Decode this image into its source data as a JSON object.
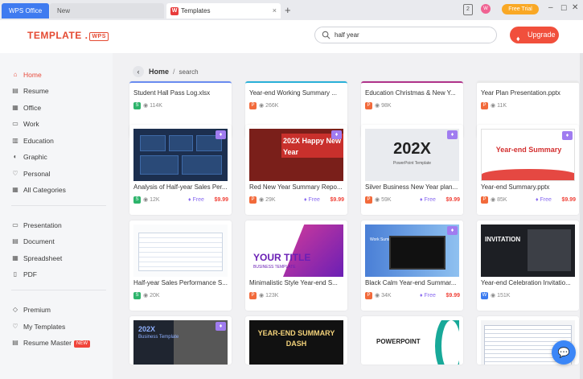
{
  "tabs": {
    "wps_office": "WPS Office",
    "new_tab": "New",
    "templates_tab": "Templates",
    "templates_icon_glyph": "W",
    "close_glyph": "×",
    "add_glyph": "+"
  },
  "titlebar": {
    "badge": "2",
    "avatar_initial": "W",
    "free_trial": "Free Trial",
    "min_glyph": "–",
    "max_glyph": "☐",
    "close_glyph": "✕"
  },
  "header": {
    "logo_text": "TEMPLATE .",
    "logo_badge": "WPS",
    "search": {
      "value": "half year"
    },
    "upgrade": "Upgrade",
    "upgrade_icon_glyph": "♦"
  },
  "sidebar": {
    "items": [
      {
        "label": "Home",
        "icon": "home-icon",
        "glyph": "⌂"
      },
      {
        "label": "Resume",
        "icon": "resume-icon",
        "glyph": "▤"
      },
      {
        "label": "Office",
        "icon": "office-icon",
        "glyph": "▦"
      },
      {
        "label": "Work",
        "icon": "briefcase-icon",
        "glyph": "▭"
      },
      {
        "label": "Education",
        "icon": "education-icon",
        "glyph": "▥"
      },
      {
        "label": "Graphic",
        "icon": "graphic-icon",
        "glyph": "◐"
      },
      {
        "label": "Personal",
        "icon": "personal-icon",
        "glyph": "♡"
      },
      {
        "label": "All Categories",
        "icon": "grid-icon",
        "glyph": "▦"
      }
    ],
    "types": [
      {
        "label": "Presentation",
        "icon": "presentation-icon",
        "glyph": "▭"
      },
      {
        "label": "Document",
        "icon": "document-icon",
        "glyph": "▤"
      },
      {
        "label": "Spreadsheet",
        "icon": "spreadsheet-icon",
        "glyph": "▦"
      },
      {
        "label": "PDF",
        "icon": "pdf-icon",
        "glyph": "▯"
      }
    ],
    "extras": [
      {
        "label": "Premium",
        "icon": "premium-icon",
        "glyph": "◇"
      },
      {
        "label": "My Templates",
        "icon": "heart-icon",
        "glyph": "♡"
      },
      {
        "label": "Resume Master",
        "icon": "resume-master-icon",
        "glyph": "▤",
        "badge": "NEW"
      }
    ]
  },
  "breadcrumb": {
    "back_glyph": "‹",
    "home": "Home",
    "sep": "/",
    "current": "search"
  },
  "cards_row0": [
    {
      "title": "Student Hall Pass Log.xlsx",
      "type": "S",
      "views": "114K"
    },
    {
      "title": "Year-end Working Summary ...",
      "type": "P",
      "views": "266K"
    },
    {
      "title": "Education Christmas & New Y...",
      "type": "P",
      "views": "98K"
    },
    {
      "title": "Year Plan Presentation.pptx",
      "type": "P",
      "views": "11K"
    }
  ],
  "cards_row1": [
    {
      "title": "Analysis of Half-year Sales Per...",
      "type": "S",
      "views": "12K",
      "free": "Free",
      "price": "$9.99",
      "thumb_text": "",
      "thumb_sub": ""
    },
    {
      "title": "Red New Year Summary Repo...",
      "type": "P",
      "views": "29K",
      "free": "Free",
      "price": "$9.99",
      "thumb_text": "202X Happy New Year",
      "thumb_sub": ""
    },
    {
      "title": "Silver Business New Year plan...",
      "type": "P",
      "views": "59K",
      "free": "Free",
      "price": "$9.99",
      "thumb_text": "202X",
      "thumb_sub": "PowerPoint Template"
    },
    {
      "title": "Year-end Summary.pptx",
      "type": "P",
      "views": "85K",
      "free": "Free",
      "price": "$9.99",
      "thumb_text": "Year-end Summary",
      "thumb_sub": ""
    }
  ],
  "cards_row2": [
    {
      "title": "Half-year Sales Performance S...",
      "type": "S",
      "views": "20K",
      "thumb_text": "",
      "thumb_sub": ""
    },
    {
      "title": "Minimalistic Style Year-end S...",
      "type": "P",
      "views": "123K",
      "thumb_text": "YOUR TITLE",
      "thumb_sub": "BUSINESS TEMPLATE"
    },
    {
      "title": "Black Calm Year-end Summar...",
      "type": "P",
      "views": "34K",
      "free": "Free",
      "price": "$9.99",
      "thumb_text": "Work Summary",
      "thumb_sub": ""
    },
    {
      "title": "Year-end Celebration Invitatio...",
      "type": "W",
      "views": "151K",
      "thumb_text": "INVITATION",
      "thumb_sub": ""
    }
  ],
  "cards_row3": [
    {
      "thumb_text": "202X",
      "thumb_sub": "Business Template"
    },
    {
      "thumb_text": "YEAR-END SUMMARY DASH",
      "thumb_sub": ""
    },
    {
      "thumb_text": "POWERPOINT",
      "thumb_sub": ""
    },
    {
      "thumb_text": "",
      "thumb_sub": ""
    }
  ],
  "vip_glyph": "♦",
  "eye_glyph": "◉",
  "free_glyph": "♦",
  "chat_glyph": "💬",
  "colors": {
    "accent": "#e84b3b",
    "tab_active": "#3f7bf0",
    "upgrade": "#f14f3c",
    "price": "#f0443a"
  }
}
